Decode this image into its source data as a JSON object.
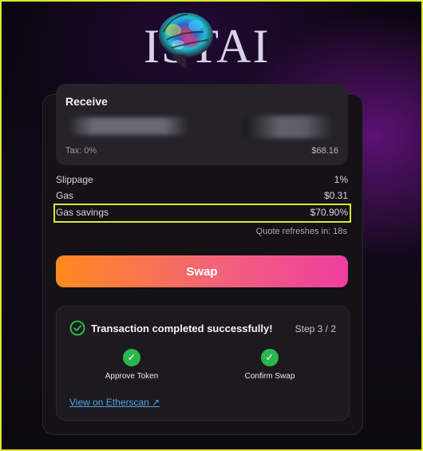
{
  "logo": {
    "text": "ISTAI",
    "image": "brain-logo"
  },
  "receive": {
    "title": "Receive",
    "tax_label": "Tax: 0%",
    "value": "$68.16"
  },
  "details": {
    "slippage_label": "Slippage",
    "slippage_value": "1%",
    "gas_label": "Gas",
    "gas_value": "$0.31",
    "gas_savings_label": "Gas savings",
    "gas_savings_value": "$70.90%",
    "quote_refresh": "Quote refreshes in: 18s"
  },
  "swap_button": {
    "label": "Swap"
  },
  "transaction": {
    "title": "Transaction completed successfully!",
    "step": "Step 3 / 2",
    "steps": [
      {
        "label": "Approve Token",
        "status": "complete"
      },
      {
        "label": "Confirm Swap",
        "status": "complete"
      }
    ],
    "etherscan_link": "View on Etherscan ↗"
  },
  "colors": {
    "highlight": "#e0e62e",
    "success": "#2ab84e",
    "link": "#4ea3e8",
    "swap_gradient_start": "#ff8a1e",
    "swap_gradient_end": "#ee3ea0"
  },
  "icons": [
    "brain-logo",
    "check-circle-icon",
    "check-icon"
  ]
}
